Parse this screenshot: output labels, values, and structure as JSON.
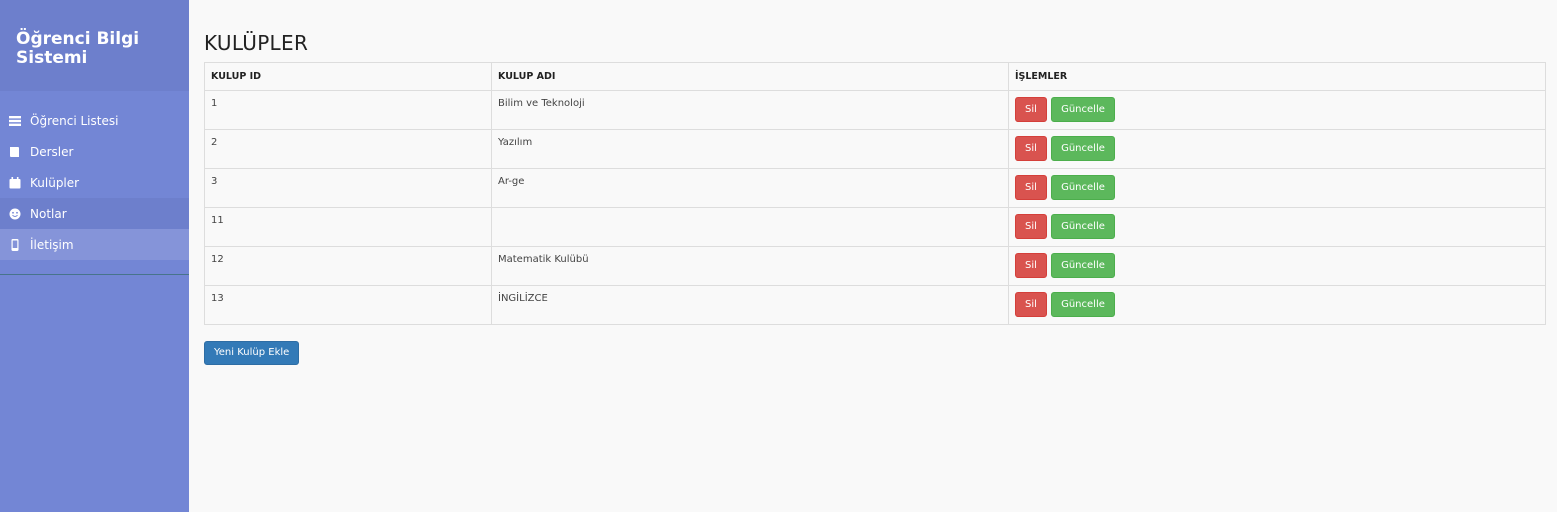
{
  "sidebar": {
    "title": "Öğrenci Bilgi Sistemi",
    "items": [
      {
        "label": "Öğrenci Listesi",
        "icon": "list-icon"
      },
      {
        "label": "Dersler",
        "icon": "book-icon"
      },
      {
        "label": "Kulüpler",
        "icon": "calendar-icon"
      },
      {
        "label": "Notlar",
        "icon": "smile-icon"
      },
      {
        "label": "İletişim",
        "icon": "mobile-icon"
      }
    ]
  },
  "main": {
    "title": "KULÜPLER",
    "table": {
      "headers": [
        "KULUP ID",
        "KULUP ADI",
        "İŞLEMLER"
      ],
      "rows": [
        {
          "id": "1",
          "name": "Bilim ve Teknoloji"
        },
        {
          "id": "2",
          "name": "Yazılım"
        },
        {
          "id": "3",
          "name": "Ar-ge"
        },
        {
          "id": "11",
          "name": ""
        },
        {
          "id": "12",
          "name": "Matematik Kulübü"
        },
        {
          "id": "13",
          "name": "İNGİLİZCE"
        }
      ],
      "delete_label": "Sil",
      "update_label": "Güncelle"
    },
    "add_button_label": "Yeni Kulüp Ekle"
  },
  "colors": {
    "sidebar": "#7386d5",
    "sidebar_header": "#6d7fcc",
    "danger": "#d9534f",
    "success": "#5cb85c",
    "primary": "#337ab7"
  }
}
